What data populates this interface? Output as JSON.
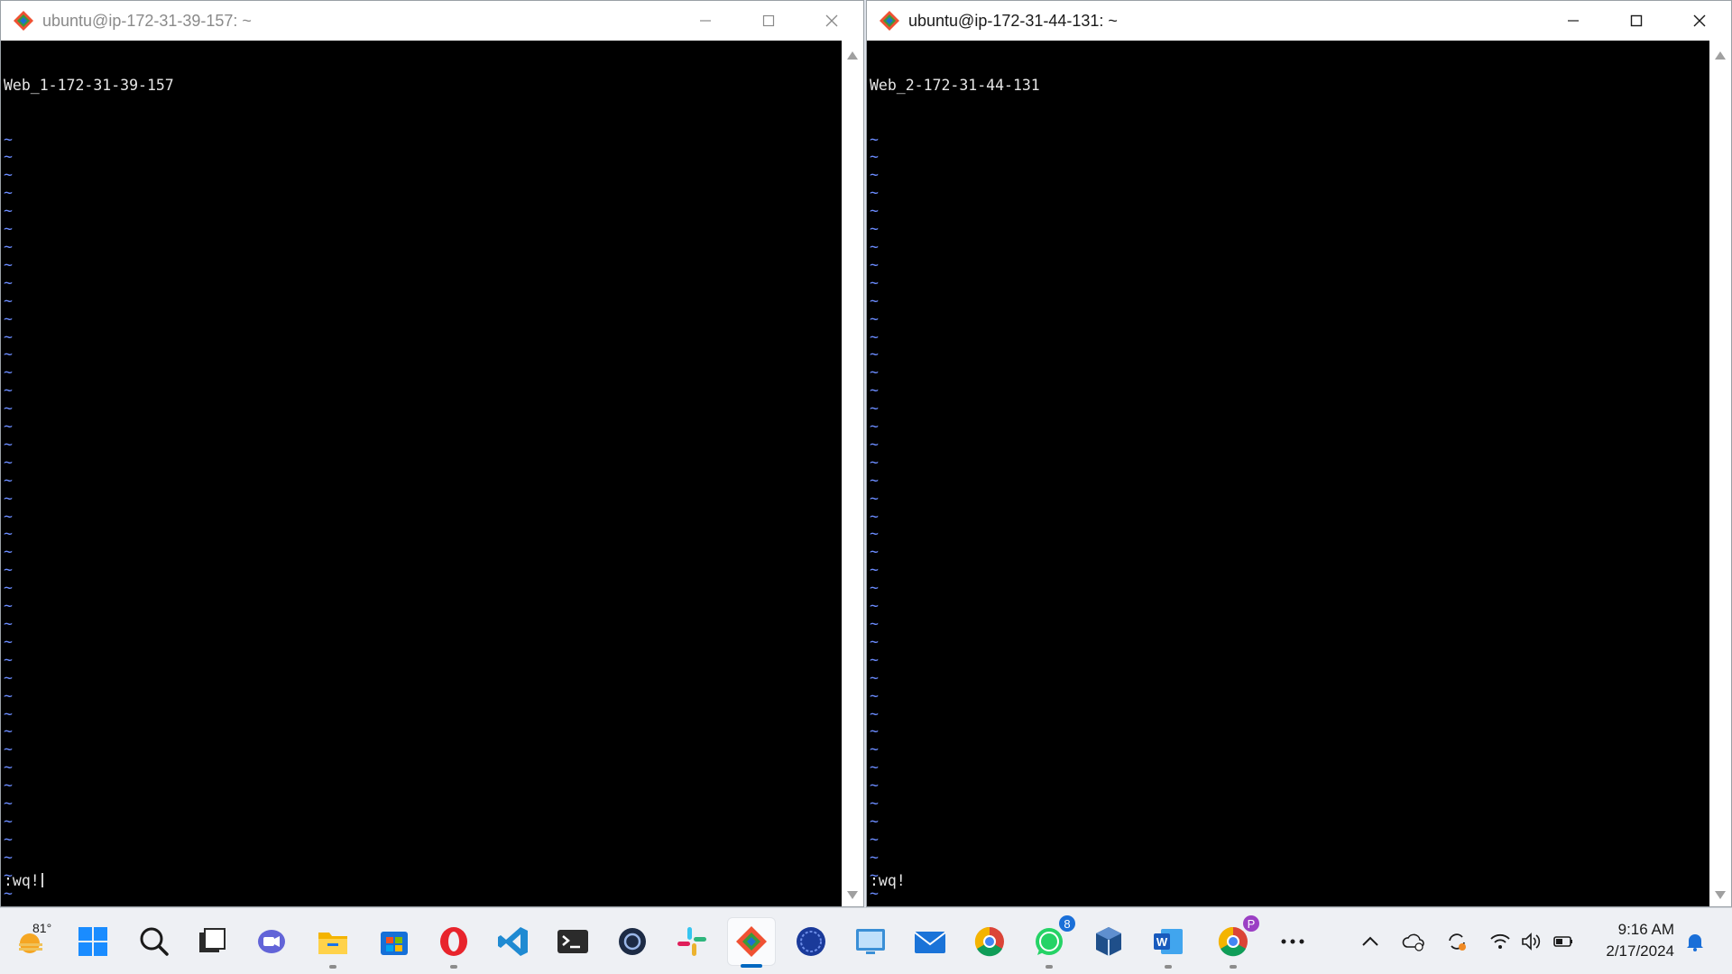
{
  "left_window": {
    "title": "ubuntu@ip-172-31-39-157: ~",
    "first_line": "Web_1-172-31-39-157",
    "tilde_char": "~",
    "command_line": ":wq!"
  },
  "right_window": {
    "title": "ubuntu@ip-172-31-44-131: ~",
    "first_line": "Web_2-172-31-44-131",
    "tilde_char": "~",
    "command_line": ":wq!"
  },
  "taskbar": {
    "weather_temp": "81°",
    "whatsapp_badge": "8",
    "chrome_profile_badge": "P",
    "apps": [
      "weather-icon",
      "start-icon",
      "search-icon",
      "task-view-icon",
      "teams-chat-icon",
      "file-explorer-icon",
      "store-icon",
      "opera-icon",
      "vscode-icon",
      "terminal-icon",
      "app-icon",
      "slack-icon",
      "git-bash-icon",
      "globe-app-icon",
      "remote-desktop-icon",
      "mail-icon",
      "chrome-icon",
      "whatsapp-icon",
      "virtualbox-icon",
      "word-icon",
      "chrome-profile-icon",
      "more-icon"
    ]
  },
  "clock": {
    "time": "9:16 AM",
    "date": "2/17/2024"
  },
  "colors": {
    "terminal_bg": "#000000",
    "tilde": "#6b8cff",
    "accent": "#0067c0"
  }
}
